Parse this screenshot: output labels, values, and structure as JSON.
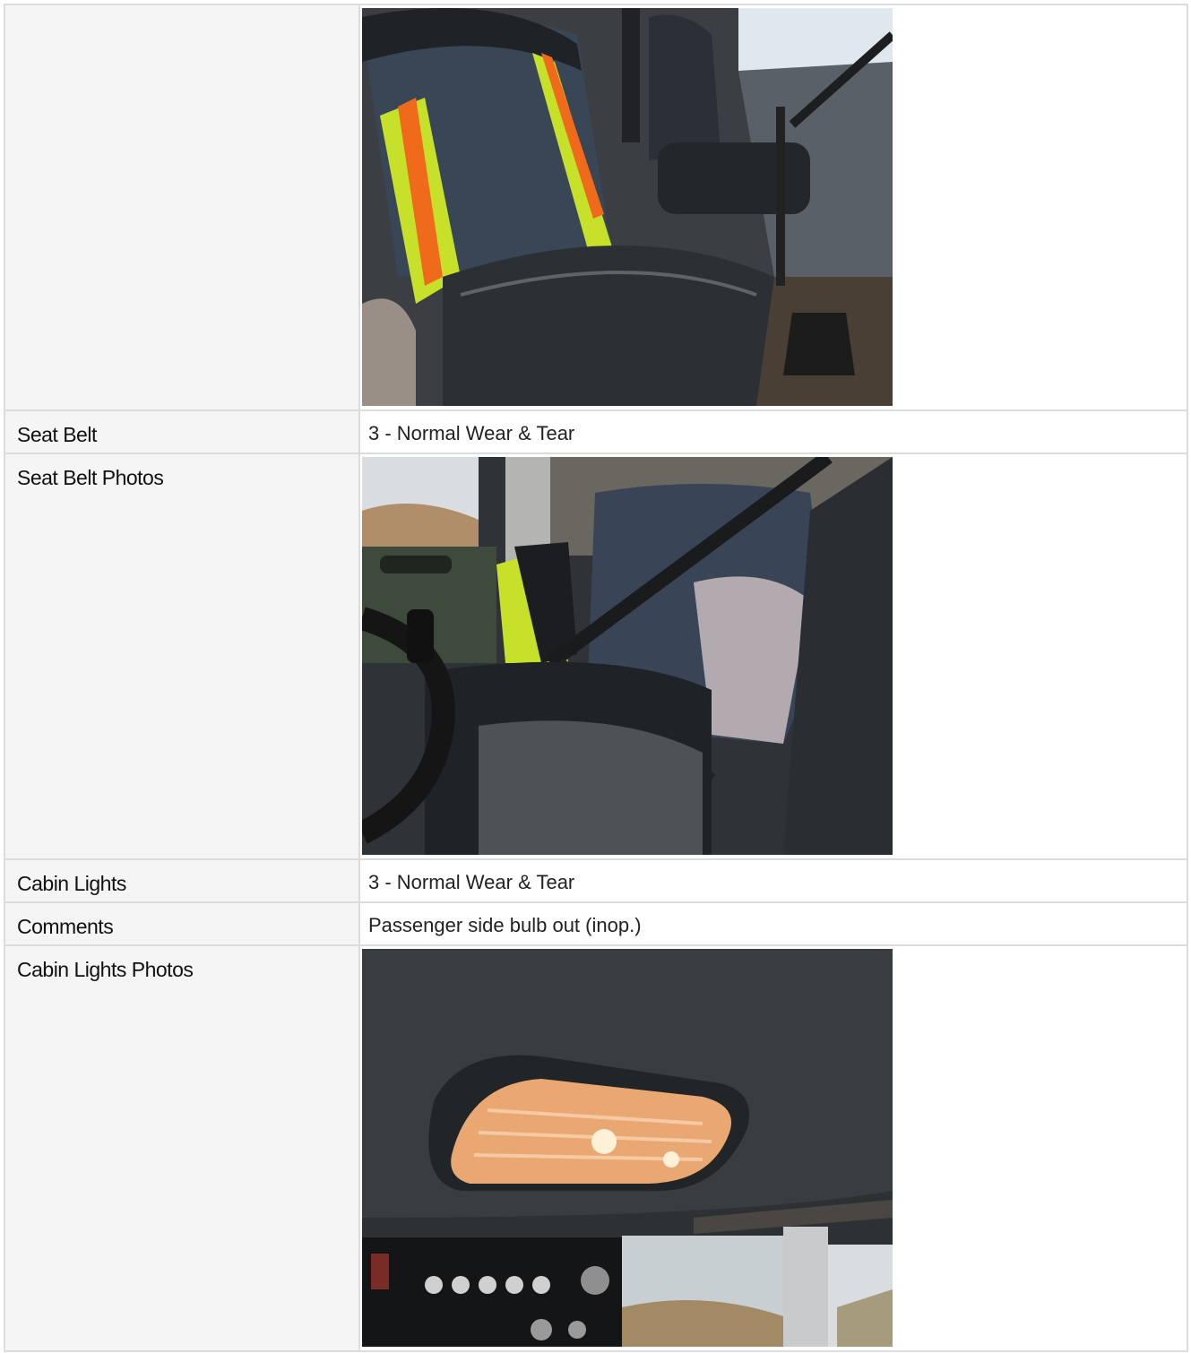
{
  "rows": [
    {
      "label": "",
      "type": "photo",
      "photo": "seat-photo"
    },
    {
      "label": "Seat Belt",
      "type": "text",
      "value": "3 - Normal Wear & Tear"
    },
    {
      "label": "Seat Belt Photos",
      "type": "photo",
      "photo": "seat-belt-photo"
    },
    {
      "label": "Cabin Lights",
      "type": "text",
      "value": "3 - Normal Wear & Tear"
    },
    {
      "label": "Comments",
      "type": "text",
      "value": "Passenger side bulb out (inop.)"
    },
    {
      "label": "Cabin Lights Photos",
      "type": "photo",
      "photo": "cabin-lights-photo"
    }
  ]
}
